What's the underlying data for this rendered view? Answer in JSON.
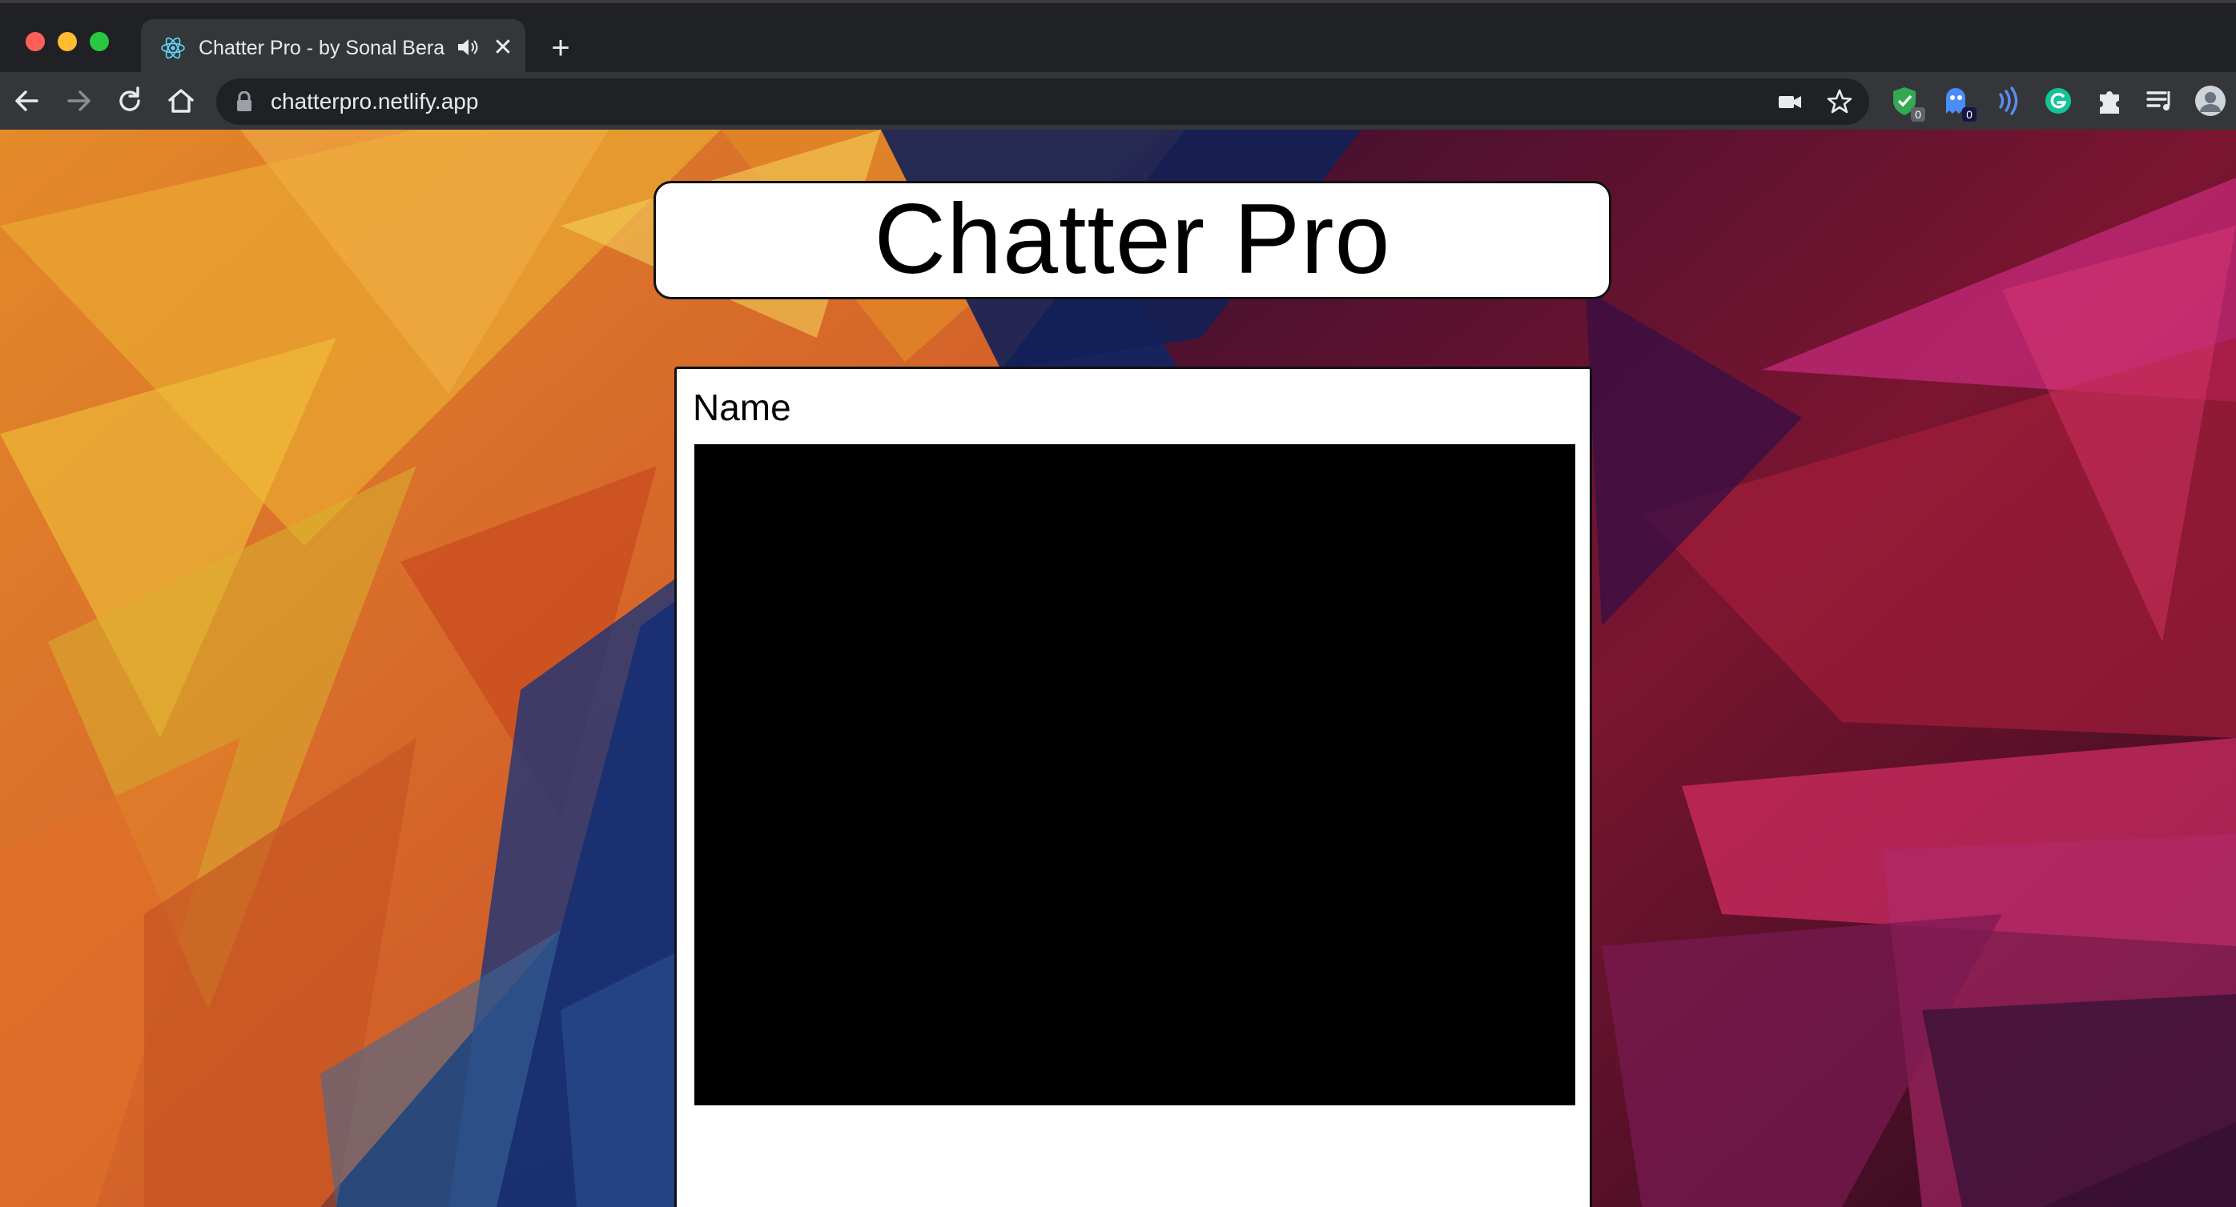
{
  "browser": {
    "tab": {
      "title": "Chatter Pro - by Sonal Bera",
      "favicon": "react-atom-icon",
      "audio_icon": "speaker-icon",
      "close_icon": "close-icon"
    },
    "new_tab_icon": "plus-icon",
    "nav": {
      "back": "arrow-left-icon",
      "forward": "arrow-right-icon",
      "reload": "reload-icon",
      "home": "home-icon"
    },
    "address_bar": {
      "url": "chatterpro.netlify.app",
      "security_icon": "lock-icon",
      "camera_icon": "video-camera-icon",
      "bookmark_icon": "star-icon"
    },
    "extensions": [
      {
        "name": "shield-extension",
        "badge": "0"
      },
      {
        "name": "ghost-extension",
        "badge": "0"
      },
      {
        "name": "wave-extension",
        "badge": ""
      },
      {
        "name": "grammarly-extension",
        "badge": ""
      }
    ],
    "toolbar_icons": [
      "puzzle-icon",
      "media-queue-icon",
      "profile-avatar"
    ],
    "colors": {
      "tabstrip": "#202124",
      "toolbar": "#35363a",
      "omnibox": "#202124",
      "text": "#e8eaed"
    }
  },
  "page": {
    "title": "Chatter Pro",
    "chat_panel": {
      "name_label": "Name"
    },
    "colors": {
      "card_bg": "#ffffff",
      "chat_area": "#000000"
    }
  }
}
